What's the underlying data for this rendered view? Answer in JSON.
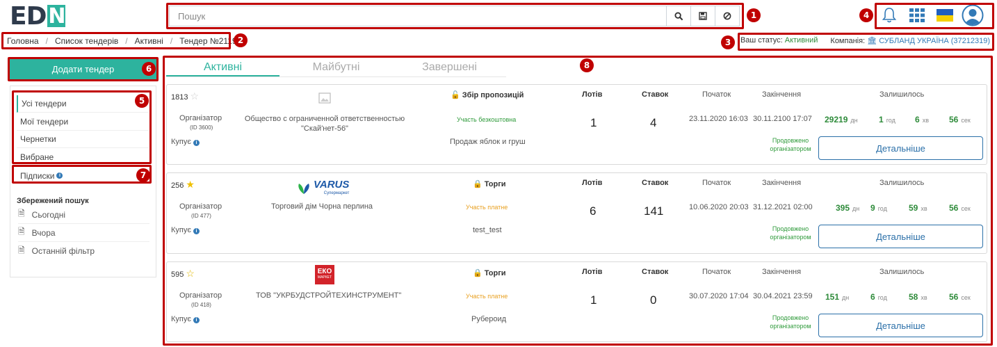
{
  "header": {
    "logo_text": "ED",
    "logo_accent": "N",
    "search_placeholder": "Пошук"
  },
  "breadcrumb": [
    "Головна",
    "Список тендерів",
    "Активні",
    "Тендер №2119"
  ],
  "status": {
    "label": "Ваш статус:",
    "value": "Активний",
    "company_label": "Компанія:",
    "company_value": "СУБЛАНД УКРАЇНА (37212319)"
  },
  "sidebar": {
    "add_button": "Додати тендер",
    "menu": [
      "Усі тендери",
      "Мої тендери",
      "Чернетки",
      "Вибране"
    ],
    "subscriptions": "Підписки",
    "saved_title": "Збережений пошук",
    "saved": [
      "Сьогодні",
      "Вчора",
      "Останній фільтр"
    ]
  },
  "tabs": [
    "Активні",
    "Майбутні",
    "Завершені"
  ],
  "labels": {
    "organizer": "Організатор",
    "buys": "Купує",
    "lots": "Лотів",
    "bids": "Ставок",
    "start": "Початок",
    "end": "Закінчення",
    "remaining": "Залишилось",
    "extended": "Продовжено організатором",
    "details": "Детальніше",
    "u_days": "дн",
    "u_hours": "год",
    "u_min": "хв",
    "u_sec": "сек"
  },
  "tenders": [
    {
      "num": "1813",
      "org_id": "(ID 3600)",
      "org_name_1": "Общество с ограниченной ответственностью",
      "org_name_2": "\"Скай'нет-56\"",
      "type": "Збір пропозицій",
      "participation": "Участь безкоштовна",
      "subject": "Продаж яблок и груш",
      "lots": "1",
      "bids": "4",
      "start": "23.11.2020 16:03",
      "end": "30.11.2100 17:07",
      "days": "29219",
      "hours": "1",
      "mins": "6",
      "secs": "56"
    },
    {
      "num": "256",
      "org_id": "(ID 477)",
      "org_name_1": "Торговий дім Чорна перлина",
      "org_name_2": "",
      "logo_text": "VARUS",
      "logo_sub": "Супермаркет",
      "type": "Торги",
      "participation": "Участь платне",
      "subject": "test_test",
      "lots": "6",
      "bids": "141",
      "start": "10.06.2020 20:03",
      "end": "31.12.2021 02:00",
      "days": "395",
      "hours": "9",
      "mins": "59",
      "secs": "56"
    },
    {
      "num": "595",
      "org_id": "(ID 418)",
      "org_name_1": "ТОВ \"УКРБУДСТРОЙТЕХИНСТРУМЕНТ\"",
      "org_name_2": "",
      "logo_text": "ЕКО",
      "logo_sub": "МАРКЕТ",
      "type": "Торги",
      "participation": "Участь платне",
      "subject": "Рубероид",
      "lots": "1",
      "bids": "0",
      "start": "30.07.2020 17:04",
      "end": "30.04.2021 23:59",
      "days": "151",
      "hours": "6",
      "mins": "58",
      "secs": "56"
    }
  ],
  "annotations": [
    "1",
    "2",
    "3",
    "4",
    "5",
    "6",
    "7",
    "8"
  ],
  "colors": {
    "accent": "#2db39e",
    "annotation": "#c00000",
    "link": "#337ab7",
    "green": "#2e8b3a",
    "orange": "#e8a020"
  }
}
